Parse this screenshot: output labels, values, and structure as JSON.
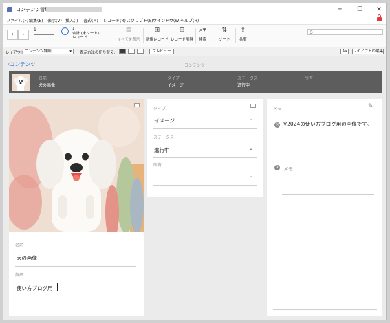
{
  "window": {
    "title": "コンテンツ管理 (",
    "minimize": "─",
    "maximize": "☐",
    "close": "✕"
  },
  "menu": [
    "ファイル(F)",
    "編集(E)",
    "表示(V)",
    "挿入(I)",
    "書式(M)",
    "レコード(R)",
    "スクリプト(S)",
    "ウインドウ(W)",
    "ヘルプ(H)"
  ],
  "toolbar": {
    "record_number": "1",
    "found_count": "1",
    "found_text_1": "合計 (未ソート)",
    "found_text_2": "レコード",
    "show_all": "すべてを表示",
    "new_record": "新規レコード",
    "delete_record": "レコード削除",
    "find": "検索",
    "sort": "ソート",
    "share": "共有",
    "search_placeholder": "Q"
  },
  "layoutbar": {
    "layout_label": "レイアウト:",
    "layout_value": "コンテンツ詳細",
    "view_label": "表示方法の切り替え:",
    "preview": "プレビュー",
    "aa": "Aa",
    "edit_layout": "レイアウトの編集"
  },
  "content": {
    "back_label": "コンテンツ",
    "page_title": "コンテンツ",
    "header": {
      "name_label": "名前",
      "name_value": "犬の画像",
      "type_label": "タイプ",
      "type_value": "イメージ",
      "status_label": "ステータス",
      "status_value": "進行中",
      "owner_label": "所有"
    },
    "fields": {
      "name_label": "名前",
      "name_value": "犬の画像",
      "detail_label": "詳細",
      "detail_value": "使い方ブログ用",
      "type_label": "タイプ",
      "type_value": "イメージ",
      "status_label": "ステータス",
      "status_value": "進行中",
      "owner_label": "所有",
      "owner_value": ""
    },
    "memo": {
      "title": "メモ",
      "entry_1": "V2024の使い方ブログ用の画像です。",
      "entry_2_placeholder": "メモ"
    }
  },
  "colors": {
    "accent": "#2f6ecb",
    "header_bg": "#5d5d5d",
    "lock": "#e03a3a"
  }
}
